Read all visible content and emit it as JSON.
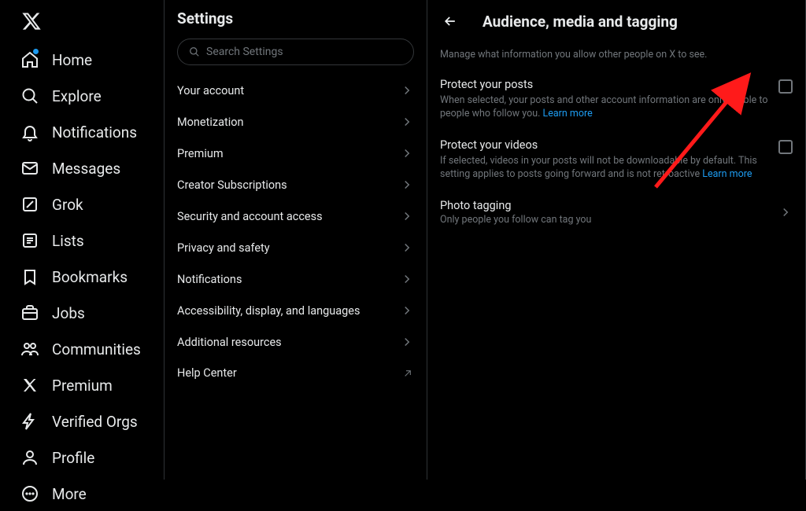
{
  "nav": {
    "items": [
      {
        "label": "Home"
      },
      {
        "label": "Explore"
      },
      {
        "label": "Notifications"
      },
      {
        "label": "Messages"
      },
      {
        "label": "Grok"
      },
      {
        "label": "Lists"
      },
      {
        "label": "Bookmarks"
      },
      {
        "label": "Jobs"
      },
      {
        "label": "Communities"
      },
      {
        "label": "Premium"
      },
      {
        "label": "Verified Orgs"
      },
      {
        "label": "Profile"
      },
      {
        "label": "More"
      }
    ]
  },
  "settings": {
    "title": "Settings",
    "search_placeholder": "Search Settings",
    "items": [
      {
        "label": "Your account"
      },
      {
        "label": "Monetization"
      },
      {
        "label": "Premium"
      },
      {
        "label": "Creator Subscriptions"
      },
      {
        "label": "Security and account access"
      },
      {
        "label": "Privacy and safety"
      },
      {
        "label": "Notifications"
      },
      {
        "label": "Accessibility, display, and languages"
      },
      {
        "label": "Additional resources"
      },
      {
        "label": "Help Center"
      }
    ]
  },
  "detail": {
    "title": "Audience, media and tagging",
    "subtitle": "Manage what information you allow other people on X to see.",
    "protect_posts": {
      "title": "Protect your posts",
      "desc_a": "When selected, your posts and other account information are only visible to people who follow you. ",
      "learn": "Learn more"
    },
    "protect_videos": {
      "title": "Protect your videos",
      "desc_a": "If selected, videos in your posts will not be downloadable by default. This setting applies to posts going forward and is not retroactive ",
      "learn": "Learn more"
    },
    "photo_tagging": {
      "title": "Photo tagging",
      "desc": "Only people you follow can tag you"
    }
  }
}
